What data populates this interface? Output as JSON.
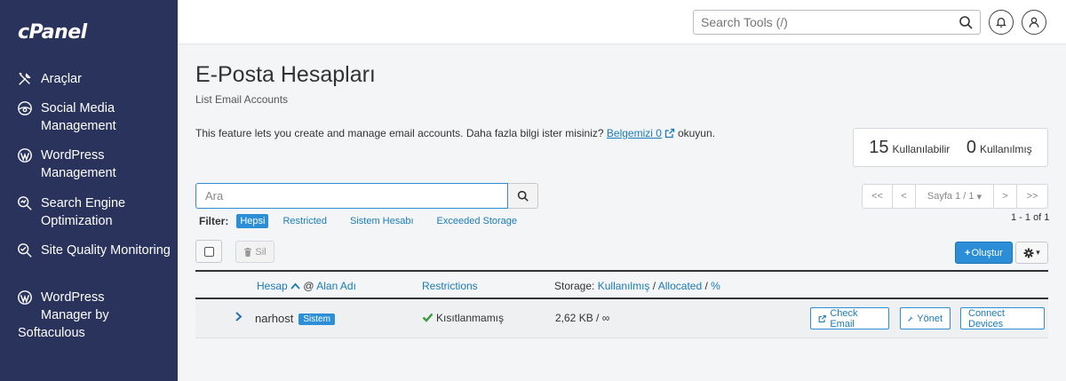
{
  "sidebar": {
    "logo": "cPanel",
    "items": [
      {
        "label": "Araçlar",
        "icon": "tools-icon"
      },
      {
        "label": "Social Media Management",
        "icon": "social-media-icon"
      },
      {
        "label": "WordPress Management",
        "icon": "wordpress-icon"
      },
      {
        "label": "Search Engine Optimization",
        "icon": "seo-icon"
      },
      {
        "label": "Site Quality Monitoring",
        "icon": "site-quality-icon"
      },
      {
        "label_line1": "WordPress",
        "label_line2": "Manager by",
        "label_line3": "Softaculous",
        "icon": "wordpress-icon"
      }
    ]
  },
  "topbar": {
    "search_placeholder": "Search Tools (/)"
  },
  "page": {
    "title": "E-Posta Hesapları",
    "subtitle": "List Email Accounts",
    "feature_text": "This feature lets you create and manage email accounts. Daha fazla bilgi ister misiniz? ",
    "feature_link": "Belgemizi 0",
    "feature_suffix": "okuyun."
  },
  "stats": {
    "available_num": "15",
    "available_label": "Kullanılabilir",
    "used_num": "0",
    "used_label": "Kullanılmış"
  },
  "search": {
    "placeholder": "Ara"
  },
  "filter": {
    "label": "Filter:",
    "options": [
      "Hepsi",
      "Restricted",
      "Sistem Hesabı",
      "Exceeded Storage"
    ]
  },
  "pager": {
    "first": "<<",
    "prev": "<",
    "page": "Sayfa 1 / 1",
    "next": ">",
    "last": ">>",
    "count": "1 - 1 of 1"
  },
  "toolbar": {
    "delete_label": "Sil",
    "create_label": "Oluştur"
  },
  "table": {
    "col_account": "Hesap",
    "col_at": "@",
    "col_domain": "Alan Adı",
    "col_restrictions": "Restrictions",
    "col_storage_prefix": "Storage:",
    "col_used": "Kullanılmış",
    "col_allocated": "Allocated",
    "col_percent": "%",
    "sep": "/",
    "rows": [
      {
        "account": "narhost",
        "badge": "Sistem",
        "restriction": "Kısıtlanmamış",
        "storage": "2,62 KB / ∞",
        "btn_check": "Check Email",
        "btn_manage": "Yönet",
        "btn_connect": "Connect Devices"
      }
    ]
  },
  "colors": {
    "sidebar_bg": "#29335c",
    "accent": "#2c8ed6",
    "link": "#1a7bb9",
    "success": "#3c9a3c"
  }
}
